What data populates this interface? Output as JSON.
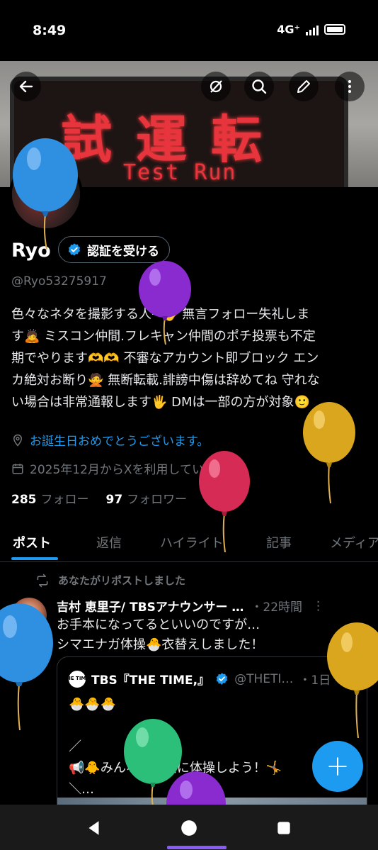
{
  "status_bar": {
    "time": "8:49",
    "network": "4G⁺"
  },
  "banner": {
    "led_kanji": "試運転",
    "led_english": "Test Run"
  },
  "toolbar": {
    "back": "back-arrow-icon",
    "grok": "grok-icon",
    "search": "search-icon",
    "edit": "edit-pencil-icon",
    "more": "more-vertical-icon"
  },
  "profile": {
    "name": "Ryo",
    "verify_label": "認証を受ける",
    "handle": "@Ryo53275917",
    "bio": "色々なネタを撮影する人→🖐 無言フォロー失礼しま\nす🙇 ミスコン仲間.フレキャン仲間のポチ投票も不定\n期でやります🫶🫶 不審なアカウント即ブロック エン\nカ絶対お断り🙅 無断転載.誹謗中傷は辞めてね 守れな\nい場合は非常通報します🖐 DMは一部の方が対象🙂",
    "birthday": "お誕生日おめでとうございます。",
    "joined": "2025年12月からXを利用しています",
    "following_count": "285",
    "following_label": "フォロー",
    "followers_count": "97",
    "followers_label": "フォロワー"
  },
  "tabs": [
    "ポスト",
    "返信",
    "ハイライト",
    "記事",
    "メディア"
  ],
  "tweet": {
    "repost_label": "あなたがリポストしました",
    "author": "吉村 恵里子/ TBSアナウンサー …",
    "time": "・22時間",
    "more": "⋮",
    "text": "お手本になってるといいのですが…\nシマエナガ体操🐣衣替えしました！",
    "quote": {
      "logo": "THE TIME,",
      "author": "TBS『THE TIME,』",
      "handle": "@THETI…",
      "time": "・1日",
      "text": "🐣🐣🐣\n\n／\n📢🐥みんなも一緒に体操しよう！🤸\n＼…"
    }
  },
  "fab": {
    "label": "+"
  },
  "colors": {
    "accent": "#1d9bf0",
    "text_secondary": "#71767b",
    "led_red": "#e8343c"
  },
  "balloons": [
    {
      "color": "#2f8fe0",
      "name": "blue"
    },
    {
      "color": "#8a2bd0",
      "name": "purple"
    },
    {
      "color": "#d9a61e",
      "name": "gold"
    },
    {
      "color": "#d62b55",
      "name": "red"
    },
    {
      "color": "#2f8fe0",
      "name": "blue"
    },
    {
      "color": "#d9a61e",
      "name": "gold"
    },
    {
      "color": "#2bbf7a",
      "name": "green"
    },
    {
      "color": "#8a2bd0",
      "name": "purple"
    }
  ]
}
